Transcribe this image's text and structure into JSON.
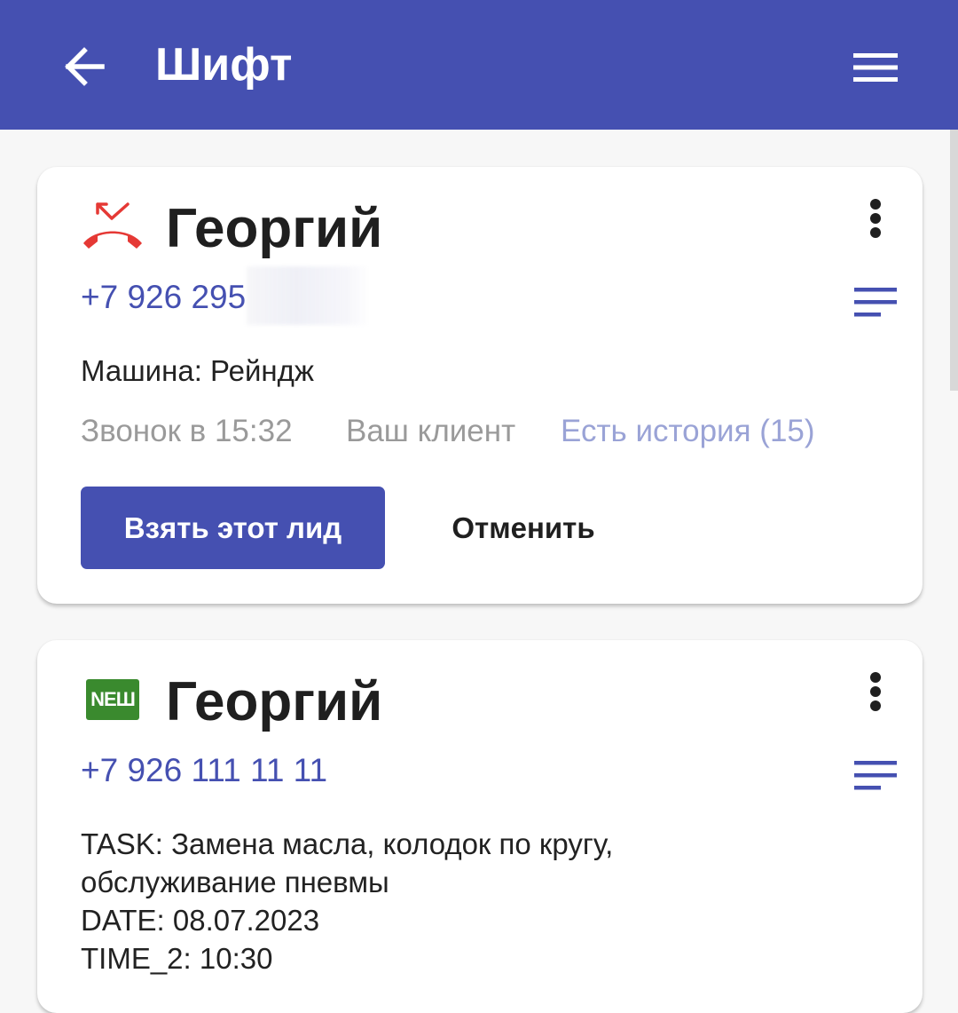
{
  "appbar": {
    "title": "Шифт",
    "back_icon": "arrow-left-icon",
    "menu_icon": "hamburger-menu-icon",
    "background_color": "#4550b1"
  },
  "cards": [
    {
      "status_icon": "missed-call-icon",
      "status_color": "#e53935",
      "name": "Георгий",
      "phone": "+7 926 295",
      "car": "Машина: Рейндж",
      "call_time": "Звонок в 15:32",
      "client_status": "Ваш клиент",
      "history": "Есть история (15)",
      "primary_action": "Взять этот лид",
      "secondary_action": "Отменить"
    },
    {
      "status_icon": "new-badge-icon",
      "badge_label": "NEШ",
      "badge_color": "#3a8a2e",
      "name": "Георгий",
      "phone": "+7 926 111 11 11",
      "task": "TASK: Замена масла, колодок по кругу,\nобслуживание пневмы\nDATE: 08.07.2023\nTIME_2: 10:30"
    }
  ]
}
